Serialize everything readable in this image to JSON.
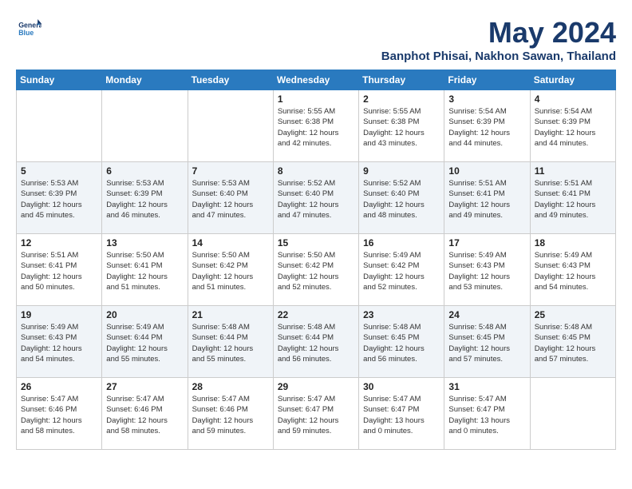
{
  "header": {
    "logo_line1": "General",
    "logo_line2": "Blue",
    "month_year": "May 2024",
    "location": "Banphot Phisai, Nakhon Sawan, Thailand"
  },
  "days_of_week": [
    "Sunday",
    "Monday",
    "Tuesday",
    "Wednesday",
    "Thursday",
    "Friday",
    "Saturday"
  ],
  "weeks": [
    [
      {
        "day": "",
        "info": ""
      },
      {
        "day": "",
        "info": ""
      },
      {
        "day": "",
        "info": ""
      },
      {
        "day": "1",
        "info": "Sunrise: 5:55 AM\nSunset: 6:38 PM\nDaylight: 12 hours\nand 42 minutes."
      },
      {
        "day": "2",
        "info": "Sunrise: 5:55 AM\nSunset: 6:38 PM\nDaylight: 12 hours\nand 43 minutes."
      },
      {
        "day": "3",
        "info": "Sunrise: 5:54 AM\nSunset: 6:39 PM\nDaylight: 12 hours\nand 44 minutes."
      },
      {
        "day": "4",
        "info": "Sunrise: 5:54 AM\nSunset: 6:39 PM\nDaylight: 12 hours\nand 44 minutes."
      }
    ],
    [
      {
        "day": "5",
        "info": "Sunrise: 5:53 AM\nSunset: 6:39 PM\nDaylight: 12 hours\nand 45 minutes."
      },
      {
        "day": "6",
        "info": "Sunrise: 5:53 AM\nSunset: 6:39 PM\nDaylight: 12 hours\nand 46 minutes."
      },
      {
        "day": "7",
        "info": "Sunrise: 5:53 AM\nSunset: 6:40 PM\nDaylight: 12 hours\nand 47 minutes."
      },
      {
        "day": "8",
        "info": "Sunrise: 5:52 AM\nSunset: 6:40 PM\nDaylight: 12 hours\nand 47 minutes."
      },
      {
        "day": "9",
        "info": "Sunrise: 5:52 AM\nSunset: 6:40 PM\nDaylight: 12 hours\nand 48 minutes."
      },
      {
        "day": "10",
        "info": "Sunrise: 5:51 AM\nSunset: 6:41 PM\nDaylight: 12 hours\nand 49 minutes."
      },
      {
        "day": "11",
        "info": "Sunrise: 5:51 AM\nSunset: 6:41 PM\nDaylight: 12 hours\nand 49 minutes."
      }
    ],
    [
      {
        "day": "12",
        "info": "Sunrise: 5:51 AM\nSunset: 6:41 PM\nDaylight: 12 hours\nand 50 minutes."
      },
      {
        "day": "13",
        "info": "Sunrise: 5:50 AM\nSunset: 6:41 PM\nDaylight: 12 hours\nand 51 minutes."
      },
      {
        "day": "14",
        "info": "Sunrise: 5:50 AM\nSunset: 6:42 PM\nDaylight: 12 hours\nand 51 minutes."
      },
      {
        "day": "15",
        "info": "Sunrise: 5:50 AM\nSunset: 6:42 PM\nDaylight: 12 hours\nand 52 minutes."
      },
      {
        "day": "16",
        "info": "Sunrise: 5:49 AM\nSunset: 6:42 PM\nDaylight: 12 hours\nand 52 minutes."
      },
      {
        "day": "17",
        "info": "Sunrise: 5:49 AM\nSunset: 6:43 PM\nDaylight: 12 hours\nand 53 minutes."
      },
      {
        "day": "18",
        "info": "Sunrise: 5:49 AM\nSunset: 6:43 PM\nDaylight: 12 hours\nand 54 minutes."
      }
    ],
    [
      {
        "day": "19",
        "info": "Sunrise: 5:49 AM\nSunset: 6:43 PM\nDaylight: 12 hours\nand 54 minutes."
      },
      {
        "day": "20",
        "info": "Sunrise: 5:49 AM\nSunset: 6:44 PM\nDaylight: 12 hours\nand 55 minutes."
      },
      {
        "day": "21",
        "info": "Sunrise: 5:48 AM\nSunset: 6:44 PM\nDaylight: 12 hours\nand 55 minutes."
      },
      {
        "day": "22",
        "info": "Sunrise: 5:48 AM\nSunset: 6:44 PM\nDaylight: 12 hours\nand 56 minutes."
      },
      {
        "day": "23",
        "info": "Sunrise: 5:48 AM\nSunset: 6:45 PM\nDaylight: 12 hours\nand 56 minutes."
      },
      {
        "day": "24",
        "info": "Sunrise: 5:48 AM\nSunset: 6:45 PM\nDaylight: 12 hours\nand 57 minutes."
      },
      {
        "day": "25",
        "info": "Sunrise: 5:48 AM\nSunset: 6:45 PM\nDaylight: 12 hours\nand 57 minutes."
      }
    ],
    [
      {
        "day": "26",
        "info": "Sunrise: 5:47 AM\nSunset: 6:46 PM\nDaylight: 12 hours\nand 58 minutes."
      },
      {
        "day": "27",
        "info": "Sunrise: 5:47 AM\nSunset: 6:46 PM\nDaylight: 12 hours\nand 58 minutes."
      },
      {
        "day": "28",
        "info": "Sunrise: 5:47 AM\nSunset: 6:46 PM\nDaylight: 12 hours\nand 59 minutes."
      },
      {
        "day": "29",
        "info": "Sunrise: 5:47 AM\nSunset: 6:47 PM\nDaylight: 12 hours\nand 59 minutes."
      },
      {
        "day": "30",
        "info": "Sunrise: 5:47 AM\nSunset: 6:47 PM\nDaylight: 13 hours\nand 0 minutes."
      },
      {
        "day": "31",
        "info": "Sunrise: 5:47 AM\nSunset: 6:47 PM\nDaylight: 13 hours\nand 0 minutes."
      },
      {
        "day": "",
        "info": ""
      }
    ]
  ]
}
